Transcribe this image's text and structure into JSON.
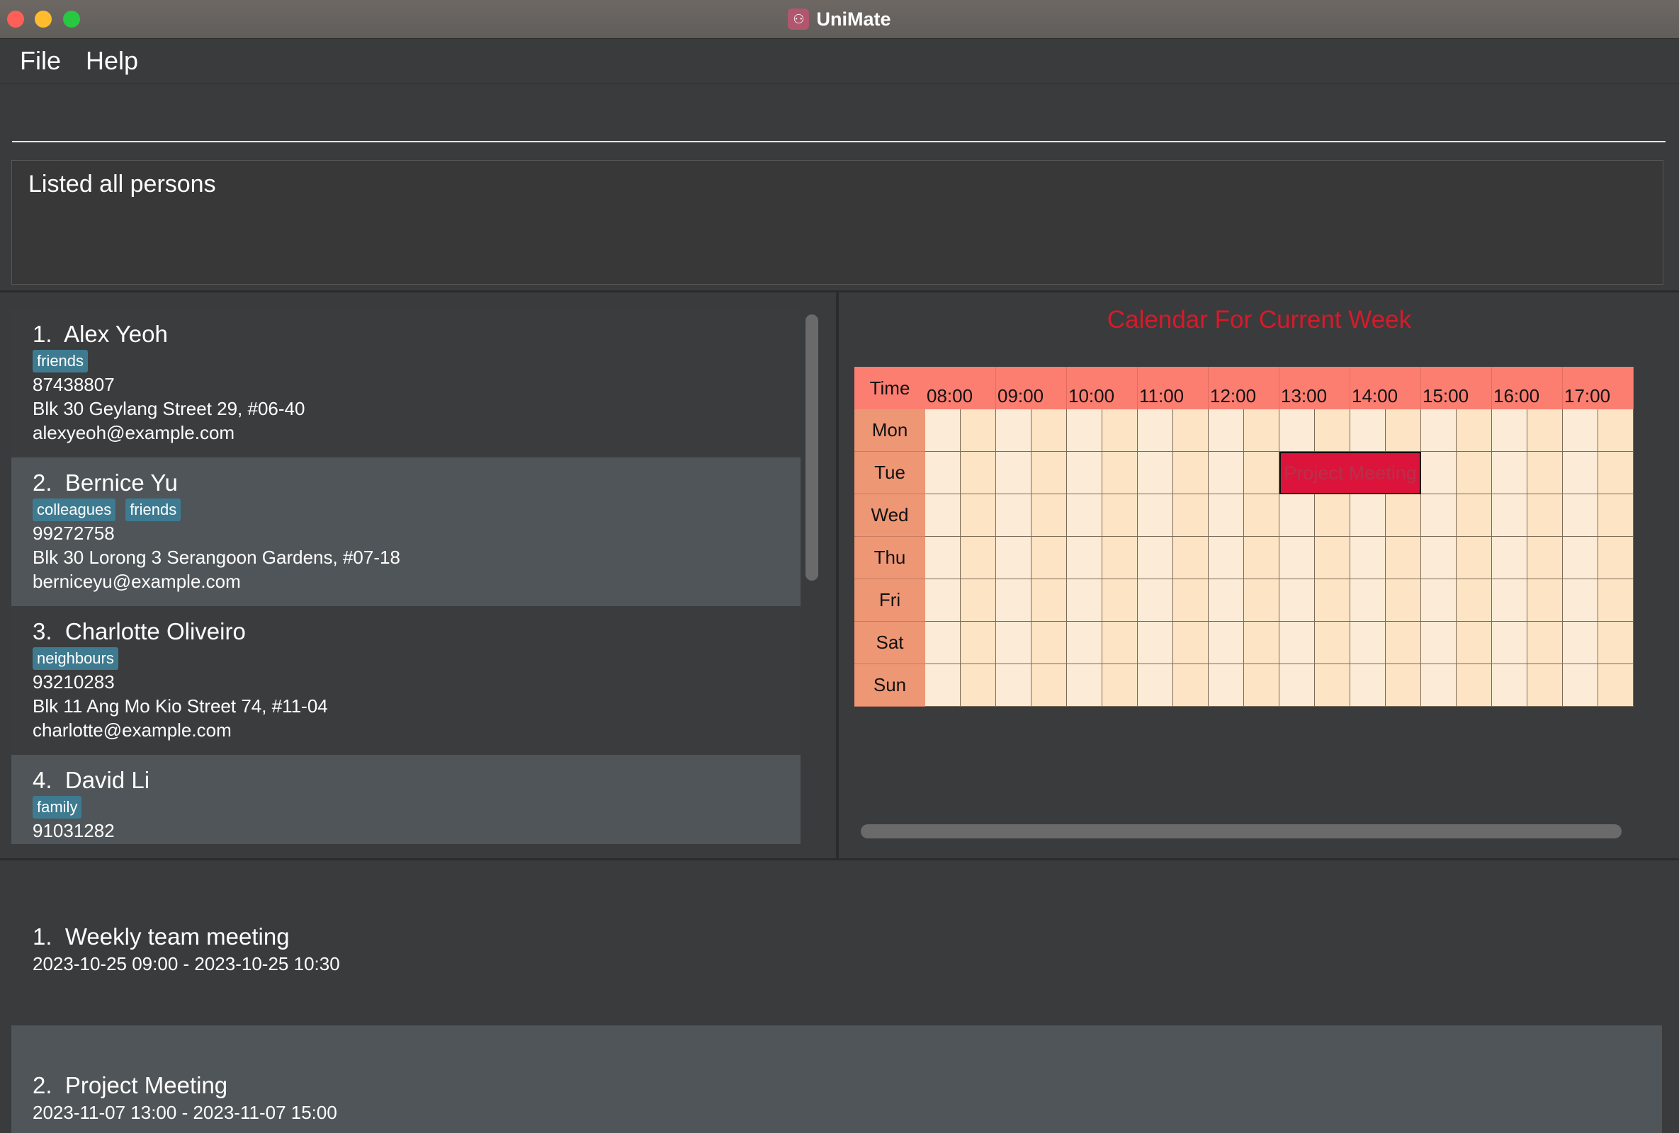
{
  "window": {
    "title": "UniMate",
    "icon": "people-icon"
  },
  "menu": {
    "file": "File",
    "help": "Help"
  },
  "command": {
    "value": "",
    "placeholder": ""
  },
  "result": {
    "message": "Listed all persons"
  },
  "persons": [
    {
      "index": "1.",
      "name": "Alex Yeoh",
      "tags": [
        "friends"
      ],
      "phone": "87438807",
      "address": "Blk 30 Geylang Street 29, #06-40",
      "email": "alexyeoh@example.com"
    },
    {
      "index": "2.",
      "name": "Bernice Yu",
      "tags": [
        "colleagues",
        "friends"
      ],
      "phone": "99272758",
      "address": "Blk 30 Lorong 3 Serangoon Gardens, #07-18",
      "email": "berniceyu@example.com"
    },
    {
      "index": "3.",
      "name": "Charlotte Oliveiro",
      "tags": [
        "neighbours"
      ],
      "phone": "93210283",
      "address": "Blk 11 Ang Mo Kio Street 74, #11-04",
      "email": "charlotte@example.com"
    },
    {
      "index": "4.",
      "name": "David Li",
      "tags": [
        "family"
      ],
      "phone": "91031282",
      "address": "",
      "email": ""
    }
  ],
  "calendar": {
    "title": "Calendar For Current Week",
    "time_label": "Time",
    "hours": [
      "08:00",
      "09:00",
      "10:00",
      "11:00",
      "12:00",
      "13:00",
      "14:00",
      "15:00",
      "16:00",
      "17:00"
    ],
    "days": [
      "Mon",
      "Tue",
      "Wed",
      "Thu",
      "Fri",
      "Sat",
      "Sun"
    ],
    "events": [
      {
        "label": "Project Meeting",
        "day": "Tue",
        "start": "13:00",
        "end": "15:00"
      }
    ],
    "colors": {
      "header": "#fb7e71",
      "day": "#ee9775",
      "slot_a": "#fcebd6",
      "slot_b": "#fde4c4",
      "event": "#dc143c",
      "title": "#d71a2a"
    }
  },
  "events": [
    {
      "index": "1.",
      "name": "Weekly team meeting",
      "time": "2023-10-25 09:00 - 2023-10-25 10:30"
    },
    {
      "index": "2.",
      "name": "Project Meeting",
      "time": "2023-11-07 13:00 - 2023-11-07 15:00"
    }
  ]
}
